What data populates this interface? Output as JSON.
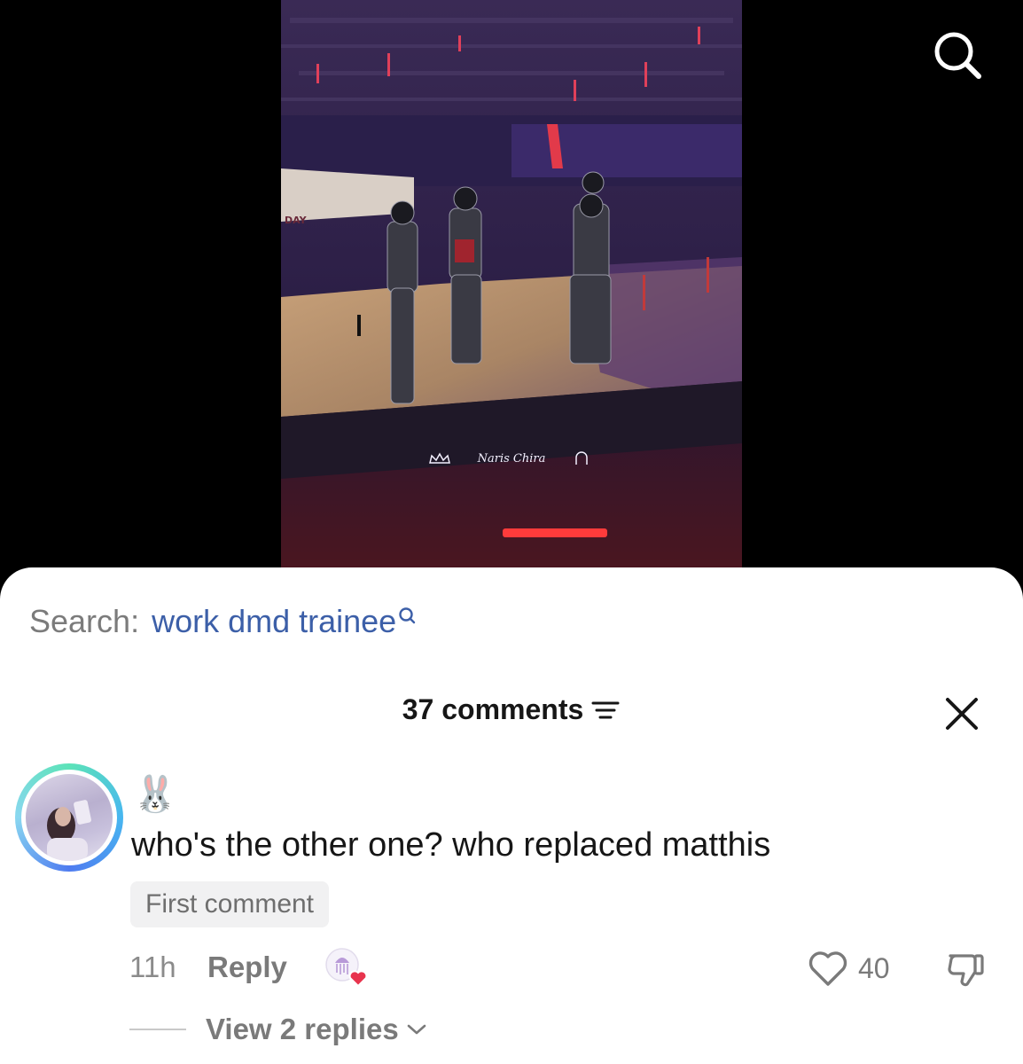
{
  "video": {
    "watermark": "Naris Chira",
    "stage_sign": "DAY"
  },
  "search_suggestion": {
    "prefix": "Search:",
    "term": "work dmd trainee"
  },
  "comments_header": {
    "count_label": "37 comments"
  },
  "comment": {
    "username_emoji": "🐰",
    "text": "who's the other one? who replaced matthis",
    "badge": "First comment",
    "time": "11h",
    "reply_label": "Reply",
    "like_count": "40",
    "view_replies": "View 2 replies"
  },
  "colors": {
    "search_term": "#3c5fa8",
    "heart_red": "#e8344e",
    "avatar_ring": "#47b6f0"
  }
}
